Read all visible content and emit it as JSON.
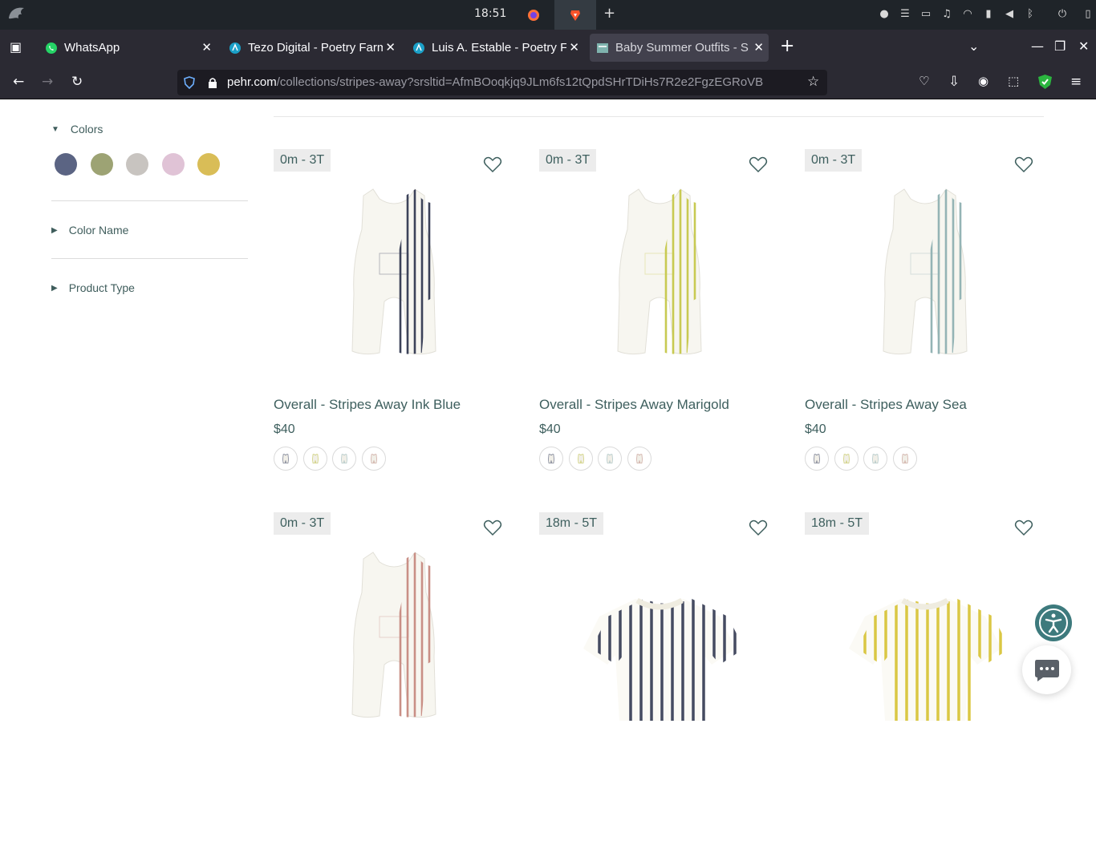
{
  "system_bar": {
    "clock": "18:51",
    "apps": [
      "firefox-icon",
      "brave-icon"
    ],
    "tray": [
      "dot-icon",
      "list-icon",
      "folder-icon",
      "bell-icon",
      "wifi-icon",
      "battery-icon",
      "volume-icon",
      "bluetooth-icon",
      "power-icon",
      "sidebar-icon"
    ]
  },
  "tabs": [
    {
      "title": "WhatsApp",
      "icon": "whatsapp-icon",
      "active": false
    },
    {
      "title": "Tezo Digital - Poetry Farm",
      "icon": "poetry-icon",
      "active": false
    },
    {
      "title": "Luis A. Estable - Poetry F",
      "icon": "poetry-icon",
      "active": false
    },
    {
      "title": "Baby Summer Outfits - S",
      "icon": "pehr-icon",
      "active": true
    }
  ],
  "url": {
    "domain": "pehr.com",
    "path": "/collections/stripes-away?srsltid=AfmBOoqkjq9JLm6fs12tQpdSHrTDiHs7R2e2FgzEGRoVB"
  },
  "filters": {
    "colors_label": "Colors",
    "swatches": [
      "#5b6483",
      "#9da374",
      "#c8c4c0",
      "#e0c3d6",
      "#d9bd57"
    ],
    "color_name_label": "Color Name",
    "product_type_label": "Product Type"
  },
  "products": [
    {
      "badge": "0m - 3T",
      "name": "Overall - Stripes Away Ink Blue",
      "price": "$40",
      "stripe": "#3c4259"
    },
    {
      "badge": "0m - 3T",
      "name": "Overall - Stripes Away Marigold",
      "price": "$40",
      "stripe": "#c8ca52"
    },
    {
      "badge": "0m - 3T",
      "name": "Overall - Stripes Away Sea",
      "price": "$40",
      "stripe": "#94b4b5"
    },
    {
      "badge": "0m - 3T",
      "name": "",
      "price": "",
      "stripe": "#c98f86"
    },
    {
      "badge": "18m - 5T",
      "name": "",
      "price": "",
      "stripe": "#3c4259"
    },
    {
      "badge": "18m - 5T",
      "name": "",
      "price": "",
      "stripe": "#d9c43a"
    }
  ],
  "mini_swatch_colors": [
    "#6d7388",
    "#c9cb6b",
    "#a9c2c2",
    "#c9a39a"
  ],
  "colors": {
    "accent": "#3e5f5e",
    "accessibility": "#3d7a7d"
  }
}
